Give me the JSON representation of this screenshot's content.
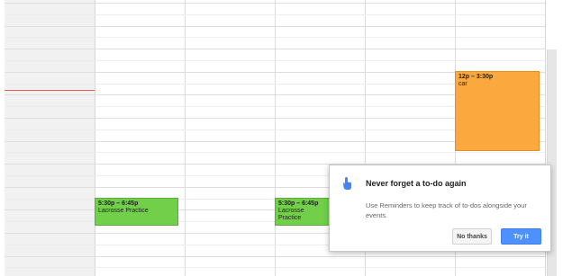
{
  "calendar": {
    "events": [
      {
        "time": "5:30p – 6:45p",
        "title": "Lacrosse Practice",
        "color": "#71cf4a"
      },
      {
        "time": "5:30p – 6:45p",
        "title": "Lacrosse Practice",
        "color": "#71cf4a"
      },
      {
        "time": "12p – 3:30p",
        "title": "car",
        "color": "#fba93f"
      }
    ],
    "now_line_color": "#e25b4e"
  },
  "reminder_promo": {
    "icon": "reminder-hand-icon",
    "title": "Never forget a to-do again",
    "body": "Use Reminders to keep track of to-dos alongside your events.",
    "secondary_button": "No thanks",
    "primary_button": "Try it",
    "accent_color": "#4d90fe"
  }
}
